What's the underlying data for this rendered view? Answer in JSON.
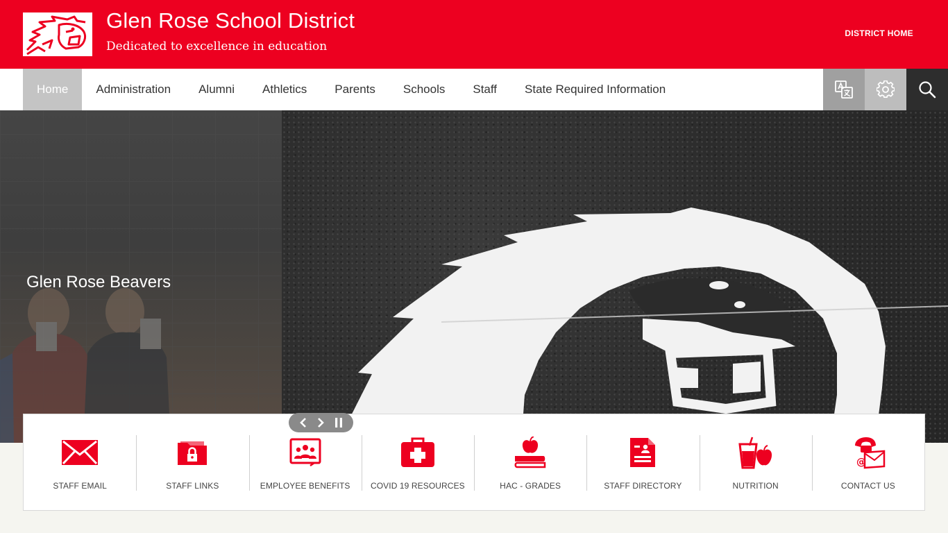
{
  "header": {
    "title": "Glen Rose School District",
    "tagline": "Dedicated to excellence in education",
    "district_home": "DISTRICT HOME",
    "brand_color": "#ed0020"
  },
  "nav": {
    "items": [
      {
        "label": "Home",
        "active": true
      },
      {
        "label": "Administration"
      },
      {
        "label": "Alumni"
      },
      {
        "label": "Athletics"
      },
      {
        "label": "Parents"
      },
      {
        "label": "Schools"
      },
      {
        "label": "Staff"
      },
      {
        "label": "State Required Information"
      }
    ],
    "tools": [
      "translate-icon",
      "gear-icon",
      "search-icon"
    ]
  },
  "hero": {
    "caption": "Glen Rose Beavers"
  },
  "quicklinks": [
    {
      "label": "STAFF EMAIL",
      "icon": "envelope-icon"
    },
    {
      "label": "STAFF LINKS",
      "icon": "locked-folder-icon"
    },
    {
      "label": "EMPLOYEE BENEFITS",
      "icon": "group-presentation-icon"
    },
    {
      "label": "COVID 19 RESOURCES",
      "icon": "first-aid-kit-icon"
    },
    {
      "label": "HAC - GRADES",
      "icon": "apple-books-icon"
    },
    {
      "label": "STAFF DIRECTORY",
      "icon": "directory-document-icon"
    },
    {
      "label": "NUTRITION",
      "icon": "drink-apple-icon"
    },
    {
      "label": "CONTACT US",
      "icon": "phone-mail-icon"
    }
  ]
}
